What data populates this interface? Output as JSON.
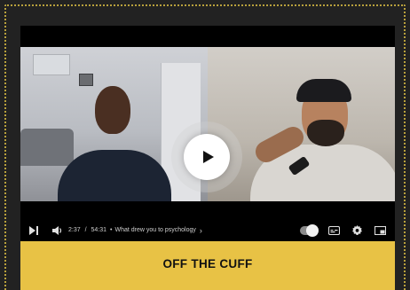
{
  "player": {
    "time_current": "2:37",
    "time_separator": "/",
    "time_total": "54:31",
    "chapter_bullet": "•",
    "chapter_title": "What drew you to psychology",
    "chapter_arrow": "›",
    "autoplay_on": true,
    "icons": {
      "next": "skip-next-icon",
      "volume": "volume-icon",
      "autoplay": "autoplay-toggle",
      "captions": "captions-icon",
      "settings": "gear-icon",
      "miniplayer": "miniplayer-icon",
      "play": "play-icon"
    }
  },
  "banner": {
    "title": "OFF THE CUFF"
  },
  "colors": {
    "banner_bg": "#e8c245",
    "page_bg": "#222222",
    "border_dots": "#b9a13c",
    "player_bg": "#000000"
  }
}
